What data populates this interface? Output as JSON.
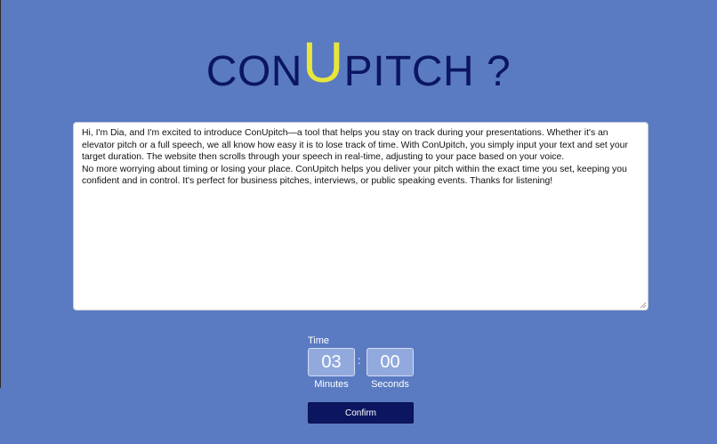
{
  "title": {
    "prefix": "CON",
    "highlight": "U",
    "suffix": "PITCH ?"
  },
  "speech": {
    "paragraph_1": "Hi, I'm Dia, and I'm excited to introduce ConUpitch—a tool that helps you stay on track during your presentations. Whether it's an elevator pitch or a full speech, we all know how easy it is to lose track of time. With ConUpitch, you simply input your text and set your target duration. The website then scrolls through your speech in real-time, adjusting to your pace based on your voice.",
    "paragraph_2": "No more worrying about timing or losing your place. ConUpitch helps you deliver your pitch within the exact time you set, keeping you confident and in control. It's perfect for business pitches, interviews, or public speaking events. Thanks for listening!"
  },
  "timer": {
    "label": "Time",
    "minutes": "03",
    "separator": ":",
    "seconds": "00",
    "minutes_label": "Minutes",
    "seconds_label": "Seconds"
  },
  "confirm_label": "Confirm",
  "colors": {
    "background": "#5a7bc2",
    "title": "#0c1660",
    "title_highlight": "#e8e63c",
    "button": "#0c1660"
  }
}
